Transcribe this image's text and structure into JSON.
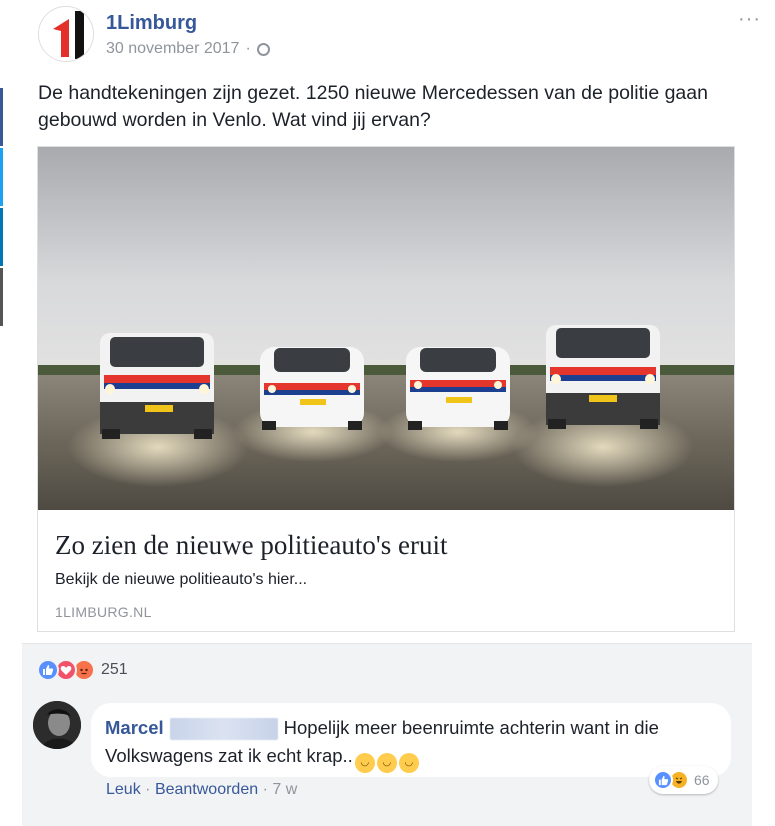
{
  "page": {
    "name": "1Limburg",
    "date": "30 november 2017",
    "separator": "·",
    "more_label": "···",
    "logo_text": "1"
  },
  "post": {
    "text": "De handtekeningen zijn gezet. 1250 nieuwe Mercedessen van de politie gaan gebouwd worden in Venlo. Wat vind jij ervan?"
  },
  "link_card": {
    "title": "Zo zien de nieuwe politieauto's eruit",
    "description": "Bekijk de nieuwe politieauto's hier...",
    "domain": "1LIMBURG.NL"
  },
  "reactions": {
    "types": [
      "like-icon",
      "love-icon",
      "angry-icon"
    ],
    "count": "251"
  },
  "comment": {
    "author": "Marcel",
    "text": "Hopelijk meer beenruimte achterin want in die Volkswagens zat ik echt krap..",
    "emoji_count": 3,
    "reaction_types": [
      "like-icon",
      "haha-icon"
    ],
    "reaction_count": "66",
    "actions": {
      "like": "Leuk",
      "reply": "Beantwoorden",
      "sep": "·",
      "time": "7 w"
    }
  },
  "colors": {
    "link_blue": "#365899",
    "meta_gray": "#90949c",
    "like_blue": "#5890ff",
    "love_red": "#f25268",
    "footer_bg": "#f2f3f5"
  }
}
